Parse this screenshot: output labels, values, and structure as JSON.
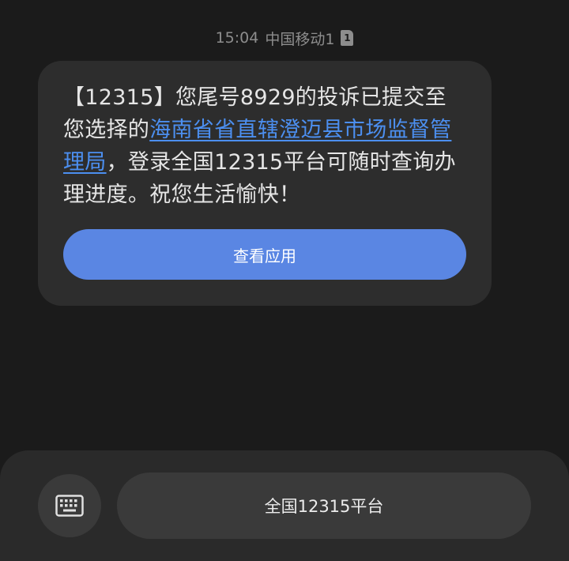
{
  "status": {
    "time": "15:04",
    "carrier": "中国移动1",
    "sim_slot": "1"
  },
  "message": {
    "text_before_link": "【12315】您尾号8929的投诉已提交至您选择的",
    "link_text": "海南省省直辖澄迈县市场监督管理局",
    "text_after_link": "，登录全国12315平台可随时查询办理进度。祝您生活愉快！",
    "action_button_label": "查看应用"
  },
  "bottom_bar": {
    "keyboard_icon": "keyboard-icon",
    "menu_button_label": "全国12315平台"
  },
  "colors": {
    "background": "#1b1b1b",
    "bubble": "#2d2d2d",
    "link": "#4c8ff0",
    "button_accent": "#5a86e3"
  }
}
